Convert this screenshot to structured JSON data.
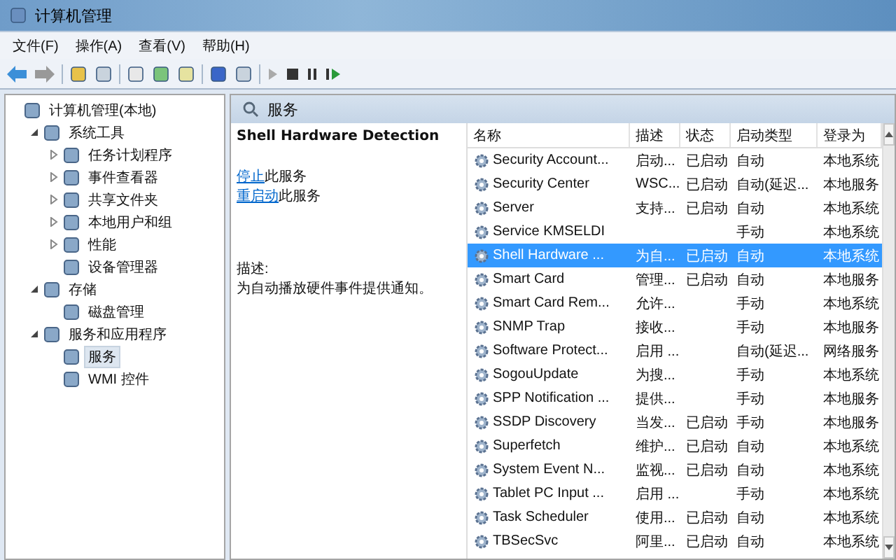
{
  "window": {
    "title": "计算机管理"
  },
  "menu": [
    "文件(F)",
    "操作(A)",
    "查看(V)",
    "帮助(H)"
  ],
  "tree": [
    {
      "label": "计算机管理(本地)",
      "selected": false,
      "children": [
        {
          "label": "系统工具",
          "expanded": true,
          "selected": false,
          "children": [
            {
              "label": "任务计划程序",
              "expanded": false,
              "selected": false
            },
            {
              "label": "事件查看器",
              "expanded": false,
              "selected": false
            },
            {
              "label": "共享文件夹",
              "expanded": false,
              "selected": false
            },
            {
              "label": "本地用户和组",
              "expanded": false,
              "selected": false
            },
            {
              "label": "性能",
              "expanded": false,
              "selected": false
            },
            {
              "label": "设备管理器",
              "selected": false
            }
          ]
        },
        {
          "label": "存储",
          "expanded": true,
          "selected": false,
          "children": [
            {
              "label": "磁盘管理",
              "selected": false
            }
          ]
        },
        {
          "label": "服务和应用程序",
          "expanded": true,
          "selected": false,
          "children": [
            {
              "label": "服务",
              "selected": true
            },
            {
              "label": "WMI 控件",
              "selected": false
            }
          ]
        }
      ]
    }
  ],
  "panel": {
    "title": "服务"
  },
  "detail": {
    "service_name": "Shell Hardware Detection",
    "actions": [
      {
        "link": "停止",
        "text": "此服务"
      },
      {
        "link": "重启动",
        "text": "此服务"
      }
    ],
    "description_label": "描述:",
    "description": "为自动播放硬件事件提供通知。"
  },
  "table": {
    "columns": [
      "名称",
      "描述",
      "状态",
      "启动类型",
      "登录为"
    ],
    "rows": [
      {
        "cells": [
          "Security Account...",
          "启动...",
          "已启动",
          "自动",
          "本地系统"
        ],
        "selected": false
      },
      {
        "cells": [
          "Security Center",
          "WSC...",
          "已启动",
          "自动(延迟...",
          "本地服务"
        ],
        "selected": false
      },
      {
        "cells": [
          "Server",
          "支持...",
          "已启动",
          "自动",
          "本地系统"
        ],
        "selected": false
      },
      {
        "cells": [
          "Service KMSELDI",
          "",
          "",
          "手动",
          "本地系统"
        ],
        "selected": false
      },
      {
        "cells": [
          "Shell Hardware ...",
          "为自...",
          "已启动",
          "自动",
          "本地系统"
        ],
        "selected": true
      },
      {
        "cells": [
          "Smart Card",
          "管理...",
          "已启动",
          "自动",
          "本地服务"
        ],
        "selected": false
      },
      {
        "cells": [
          "Smart Card Rem...",
          "允许...",
          "",
          "手动",
          "本地系统"
        ],
        "selected": false
      },
      {
        "cells": [
          "SNMP Trap",
          "接收...",
          "",
          "手动",
          "本地服务"
        ],
        "selected": false
      },
      {
        "cells": [
          "Software Protect...",
          "启用 ...",
          "",
          "自动(延迟...",
          "网络服务"
        ],
        "selected": false
      },
      {
        "cells": [
          "SogouUpdate",
          "为搜...",
          "",
          "手动",
          "本地系统"
        ],
        "selected": false
      },
      {
        "cells": [
          "SPP Notification ...",
          "提供...",
          "",
          "手动",
          "本地服务"
        ],
        "selected": false
      },
      {
        "cells": [
          "SSDP Discovery",
          "当发...",
          "已启动",
          "手动",
          "本地服务"
        ],
        "selected": false
      },
      {
        "cells": [
          "Superfetch",
          "维护...",
          "已启动",
          "自动",
          "本地系统"
        ],
        "selected": false
      },
      {
        "cells": [
          "System Event N...",
          "监视...",
          "已启动",
          "自动",
          "本地系统"
        ],
        "selected": false
      },
      {
        "cells": [
          "Tablet PC Input ...",
          "启用 ...",
          "",
          "手动",
          "本地系统"
        ],
        "selected": false
      },
      {
        "cells": [
          "Task Scheduler",
          "使用...",
          "已启动",
          "自动",
          "本地系统"
        ],
        "selected": false
      },
      {
        "cells": [
          "TBSecSvc",
          "阿里...",
          "已启动",
          "自动",
          "本地系统"
        ],
        "selected": false
      }
    ]
  }
}
